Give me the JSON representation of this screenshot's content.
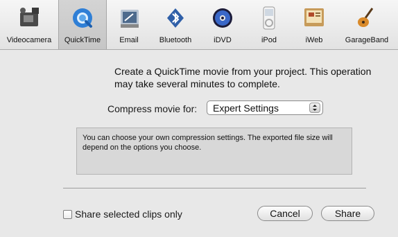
{
  "toolbar": {
    "items": [
      {
        "label": "Videocamera",
        "icon": "videocamera-icon",
        "selected": false
      },
      {
        "label": "QuickTime",
        "icon": "quicktime-icon",
        "selected": true
      },
      {
        "label": "Email",
        "icon": "email-icon",
        "selected": false
      },
      {
        "label": "Bluetooth",
        "icon": "bluetooth-icon",
        "selected": false
      },
      {
        "label": "iDVD",
        "icon": "idvd-icon",
        "selected": false
      },
      {
        "label": "iPod",
        "icon": "ipod-icon",
        "selected": false
      },
      {
        "label": "iWeb",
        "icon": "iweb-icon",
        "selected": false
      },
      {
        "label": "GarageBand",
        "icon": "garageband-icon",
        "selected": false
      }
    ]
  },
  "main": {
    "intro": "Create a QuickTime movie from your project. This operation may take several minutes to complete.",
    "compress_label": "Compress movie for:",
    "compress_value": "Expert Settings",
    "description": "You can choose your own compression settings. The exported file size will depend on the options you choose.",
    "share_clips_label": "Share selected clips only",
    "share_clips_checked": false,
    "cancel_label": "Cancel",
    "share_label": "Share"
  },
  "colors": {
    "window_bg": "#e8e8e8",
    "toolbar_selected": "#c8c8c8",
    "quicktime_blue": "#2f7fd6"
  }
}
